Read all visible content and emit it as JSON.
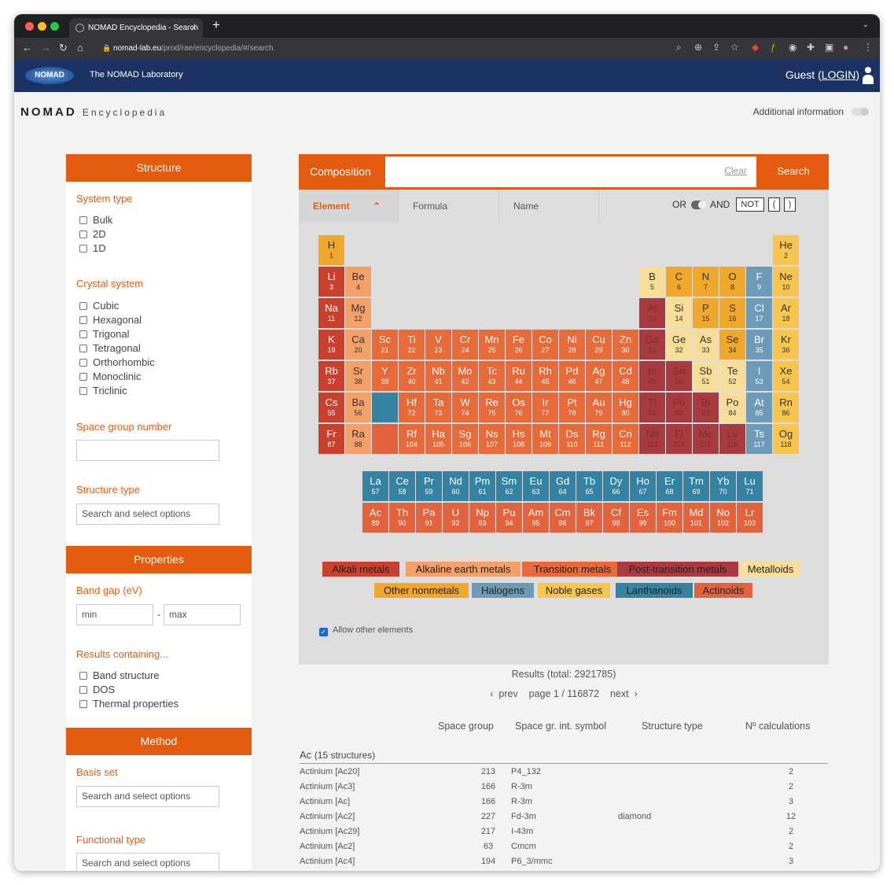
{
  "browser": {
    "tab_title": "NOMAD Encyclopedia - Search",
    "tab_close": "×",
    "new_tab": "+",
    "menu_chevron": "⌄",
    "url_host": "nomad-lab.eu",
    "url_path": "/prod/rae/encyclopedia/#/search"
  },
  "header": {
    "logo": "NOMAD",
    "lab": "The NOMAD Laboratory",
    "guest": "Guest (",
    "login": "LOGIN",
    ")": ")"
  },
  "brand": {
    "name": "NOMAD",
    "sub": "Encyclopedia"
  },
  "additional_info": "Additional information",
  "sidebar": {
    "structure": {
      "title": "Structure",
      "system_type": {
        "label": "System type",
        "options": [
          "Bulk",
          "2D",
          "1D"
        ]
      },
      "crystal_system": {
        "label": "Crystal system",
        "options": [
          "Cubic",
          "Hexagonal",
          "Trigonal",
          "Tetragonal",
          "Orthorhombic",
          "Monoclinic",
          "Triclinic"
        ]
      },
      "space_group": {
        "label": "Space group number",
        "value": ""
      },
      "structure_type": {
        "label": "Structure type",
        "placeholder": "Search and select options"
      }
    },
    "properties": {
      "title": "Properties",
      "band_gap": {
        "label": "Band gap (eV)",
        "min": "min",
        "dash": "-",
        "max": "max"
      },
      "results": {
        "label": "Results containing...",
        "options": [
          "Band structure",
          "DOS",
          "Thermal properties"
        ]
      }
    },
    "method": {
      "title": "Method",
      "basis_set": {
        "label": "Basis set",
        "placeholder": "Search and select options"
      },
      "functional_type": {
        "label": "Functional type",
        "placeholder": "Search and select options"
      }
    }
  },
  "composition": {
    "label": "Composition",
    "value": "",
    "clear": "Clear",
    "search": "Search"
  },
  "tabs": {
    "element": "Element",
    "formula": "Formula",
    "name": "Name",
    "or": "OR",
    "and": "AND",
    "not": "NOT",
    "lparen": "(",
    "rparen": ")"
  },
  "elements": [
    {
      "s": "H",
      "n": "1",
      "c": "on",
      "r": 0,
      "k": 0
    },
    {
      "s": "He",
      "n": "2",
      "c": "ng",
      "r": 0,
      "k": 17
    },
    {
      "s": "Li",
      "n": "3",
      "c": "al",
      "r": 1,
      "k": 0
    },
    {
      "s": "Be",
      "n": "4",
      "c": "ae",
      "r": 1,
      "k": 1
    },
    {
      "s": "B",
      "n": "5",
      "c": "md",
      "r": 1,
      "k": 12
    },
    {
      "s": "C",
      "n": "6",
      "c": "on",
      "r": 1,
      "k": 13
    },
    {
      "s": "N",
      "n": "7",
      "c": "on",
      "r": 1,
      "k": 14
    },
    {
      "s": "O",
      "n": "8",
      "c": "on",
      "r": 1,
      "k": 15
    },
    {
      "s": "F",
      "n": "9",
      "c": "ha",
      "r": 1,
      "k": 16
    },
    {
      "s": "Ne",
      "n": "10",
      "c": "ng",
      "r": 1,
      "k": 17
    },
    {
      "s": "Na",
      "n": "11",
      "c": "al",
      "r": 2,
      "k": 0
    },
    {
      "s": "Mg",
      "n": "12",
      "c": "ae",
      "r": 2,
      "k": 1
    },
    {
      "s": "Al",
      "n": "13",
      "c": "pt",
      "r": 2,
      "k": 12
    },
    {
      "s": "Si",
      "n": "14",
      "c": "md",
      "r": 2,
      "k": 13
    },
    {
      "s": "P",
      "n": "15",
      "c": "on",
      "r": 2,
      "k": 14
    },
    {
      "s": "S",
      "n": "16",
      "c": "on",
      "r": 2,
      "k": 15
    },
    {
      "s": "Cl",
      "n": "17",
      "c": "ha",
      "r": 2,
      "k": 16
    },
    {
      "s": "Ar",
      "n": "18",
      "c": "ng",
      "r": 2,
      "k": 17
    },
    {
      "s": "K",
      "n": "19",
      "c": "al",
      "r": 3,
      "k": 0
    },
    {
      "s": "Ca",
      "n": "20",
      "c": "ae",
      "r": 3,
      "k": 1
    },
    {
      "s": "Sc",
      "n": "21",
      "c": "tm",
      "r": 3,
      "k": 2
    },
    {
      "s": "Ti",
      "n": "22",
      "c": "tm",
      "r": 3,
      "k": 3
    },
    {
      "s": "V",
      "n": "23",
      "c": "tm",
      "r": 3,
      "k": 4
    },
    {
      "s": "Cr",
      "n": "24",
      "c": "tm",
      "r": 3,
      "k": 5
    },
    {
      "s": "Mn",
      "n": "25",
      "c": "tm",
      "r": 3,
      "k": 6
    },
    {
      "s": "Fe",
      "n": "26",
      "c": "tm",
      "r": 3,
      "k": 7
    },
    {
      "s": "Co",
      "n": "27",
      "c": "tm",
      "r": 3,
      "k": 8
    },
    {
      "s": "Ni",
      "n": "28",
      "c": "tm",
      "r": 3,
      "k": 9
    },
    {
      "s": "Cu",
      "n": "29",
      "c": "tm",
      "r": 3,
      "k": 10
    },
    {
      "s": "Zn",
      "n": "30",
      "c": "tm",
      "r": 3,
      "k": 11
    },
    {
      "s": "Ga",
      "n": "31",
      "c": "pt",
      "r": 3,
      "k": 12
    },
    {
      "s": "Ge",
      "n": "32",
      "c": "md",
      "r": 3,
      "k": 13
    },
    {
      "s": "As",
      "n": "33",
      "c": "md",
      "r": 3,
      "k": 14
    },
    {
      "s": "Se",
      "n": "34",
      "c": "on",
      "r": 3,
      "k": 15
    },
    {
      "s": "Br",
      "n": "35",
      "c": "ha",
      "r": 3,
      "k": 16
    },
    {
      "s": "Kr",
      "n": "36",
      "c": "ng",
      "r": 3,
      "k": 17
    },
    {
      "s": "Rb",
      "n": "37",
      "c": "al",
      "r": 4,
      "k": 0
    },
    {
      "s": "Sr",
      "n": "38",
      "c": "ae",
      "r": 4,
      "k": 1
    },
    {
      "s": "Y",
      "n": "39",
      "c": "tm",
      "r": 4,
      "k": 2
    },
    {
      "s": "Zr",
      "n": "40",
      "c": "tm",
      "r": 4,
      "k": 3
    },
    {
      "s": "Nb",
      "n": "41",
      "c": "tm",
      "r": 4,
      "k": 4
    },
    {
      "s": "Mo",
      "n": "42",
      "c": "tm",
      "r": 4,
      "k": 5
    },
    {
      "s": "Tc",
      "n": "43",
      "c": "tm",
      "r": 4,
      "k": 6
    },
    {
      "s": "Ru",
      "n": "44",
      "c": "tm",
      "r": 4,
      "k": 7
    },
    {
      "s": "Rh",
      "n": "45",
      "c": "tm",
      "r": 4,
      "k": 8
    },
    {
      "s": "Pd",
      "n": "46",
      "c": "tm",
      "r": 4,
      "k": 9
    },
    {
      "s": "Ag",
      "n": "47",
      "c": "tm",
      "r": 4,
      "k": 10
    },
    {
      "s": "Cd",
      "n": "48",
      "c": "tm",
      "r": 4,
      "k": 11
    },
    {
      "s": "In",
      "n": "49",
      "c": "pt",
      "r": 4,
      "k": 12
    },
    {
      "s": "Sn",
      "n": "50",
      "c": "pt",
      "r": 4,
      "k": 13
    },
    {
      "s": "Sb",
      "n": "51",
      "c": "md",
      "r": 4,
      "k": 14
    },
    {
      "s": "Te",
      "n": "52",
      "c": "md",
      "r": 4,
      "k": 15
    },
    {
      "s": "I",
      "n": "53",
      "c": "ha",
      "r": 4,
      "k": 16
    },
    {
      "s": "Xe",
      "n": "54",
      "c": "ng",
      "r": 4,
      "k": 17
    },
    {
      "s": "Cs",
      "n": "55",
      "c": "al",
      "r": 5,
      "k": 0
    },
    {
      "s": "Ba",
      "n": "56",
      "c": "ae",
      "r": 5,
      "k": 1
    },
    {
      "s": "",
      "n": "",
      "c": "la",
      "r": 5,
      "k": 2
    },
    {
      "s": "Hf",
      "n": "72",
      "c": "tm",
      "r": 5,
      "k": 3
    },
    {
      "s": "Ta",
      "n": "73",
      "c": "tm",
      "r": 5,
      "k": 4
    },
    {
      "s": "W",
      "n": "74",
      "c": "tm",
      "r": 5,
      "k": 5
    },
    {
      "s": "Re",
      "n": "75",
      "c": "tm",
      "r": 5,
      "k": 6
    },
    {
      "s": "Os",
      "n": "76",
      "c": "tm",
      "r": 5,
      "k": 7
    },
    {
      "s": "Ir",
      "n": "77",
      "c": "tm",
      "r": 5,
      "k": 8
    },
    {
      "s": "Pt",
      "n": "78",
      "c": "tm",
      "r": 5,
      "k": 9
    },
    {
      "s": "Au",
      "n": "79",
      "c": "tm",
      "r": 5,
      "k": 10
    },
    {
      "s": "Hg",
      "n": "80",
      "c": "tm",
      "r": 5,
      "k": 11
    },
    {
      "s": "Tl",
      "n": "81",
      "c": "pt",
      "r": 5,
      "k": 12
    },
    {
      "s": "Pb",
      "n": "82",
      "c": "pt",
      "r": 5,
      "k": 13
    },
    {
      "s": "Bi",
      "n": "83",
      "c": "pt",
      "r": 5,
      "k": 14
    },
    {
      "s": "Po",
      "n": "84",
      "c": "md",
      "r": 5,
      "k": 15
    },
    {
      "s": "At",
      "n": "85",
      "c": "ha",
      "r": 5,
      "k": 16
    },
    {
      "s": "Rn",
      "n": "86",
      "c": "ng",
      "r": 5,
      "k": 17
    },
    {
      "s": "Fr",
      "n": "87",
      "c": "al",
      "r": 6,
      "k": 0
    },
    {
      "s": "Ra",
      "n": "88",
      "c": "ae",
      "r": 6,
      "k": 1
    },
    {
      "s": "",
      "n": "",
      "c": "ac",
      "r": 6,
      "k": 2
    },
    {
      "s": "Rf",
      "n": "104",
      "c": "tm",
      "r": 6,
      "k": 3
    },
    {
      "s": "Ha",
      "n": "105",
      "c": "tm",
      "r": 6,
      "k": 4
    },
    {
      "s": "Sg",
      "n": "106",
      "c": "tm",
      "r": 6,
      "k": 5
    },
    {
      "s": "Ns",
      "n": "107",
      "c": "tm",
      "r": 6,
      "k": 6
    },
    {
      "s": "Hs",
      "n": "108",
      "c": "tm",
      "r": 6,
      "k": 7
    },
    {
      "s": "Mt",
      "n": "109",
      "c": "tm",
      "r": 6,
      "k": 8
    },
    {
      "s": "Ds",
      "n": "110",
      "c": "tm",
      "r": 6,
      "k": 9
    },
    {
      "s": "Rg",
      "n": "111",
      "c": "tm",
      "r": 6,
      "k": 10
    },
    {
      "s": "Cn",
      "n": "112",
      "c": "tm",
      "r": 6,
      "k": 11
    },
    {
      "s": "Nh",
      "n": "113",
      "c": "pt",
      "r": 6,
      "k": 12
    },
    {
      "s": "Fl",
      "n": "114",
      "c": "pt",
      "r": 6,
      "k": 13
    },
    {
      "s": "Mc",
      "n": "115",
      "c": "pt",
      "r": 6,
      "k": 14
    },
    {
      "s": "Lv",
      "n": "116",
      "c": "pt",
      "r": 6,
      "k": 15
    },
    {
      "s": "Ts",
      "n": "117",
      "c": "ha",
      "r": 6,
      "k": 16
    },
    {
      "s": "Og",
      "n": "118",
      "c": "ng",
      "r": 6,
      "k": 17
    },
    {
      "s": "La",
      "n": "57",
      "c": "la",
      "r": 7,
      "k": 0
    },
    {
      "s": "Ce",
      "n": "58",
      "c": "la",
      "r": 7,
      "k": 1
    },
    {
      "s": "Pr",
      "n": "59",
      "c": "la",
      "r": 7,
      "k": 2
    },
    {
      "s": "Nd",
      "n": "60",
      "c": "la",
      "r": 7,
      "k": 3
    },
    {
      "s": "Pm",
      "n": "61",
      "c": "la",
      "r": 7,
      "k": 4
    },
    {
      "s": "Sm",
      "n": "62",
      "c": "la",
      "r": 7,
      "k": 5
    },
    {
      "s": "Eu",
      "n": "63",
      "c": "la",
      "r": 7,
      "k": 6
    },
    {
      "s": "Gd",
      "n": "64",
      "c": "la",
      "r": 7,
      "k": 7
    },
    {
      "s": "Tb",
      "n": "65",
      "c": "la",
      "r": 7,
      "k": 8
    },
    {
      "s": "Dy",
      "n": "66",
      "c": "la",
      "r": 7,
      "k": 9
    },
    {
      "s": "Ho",
      "n": "67",
      "c": "la",
      "r": 7,
      "k": 10
    },
    {
      "s": "Er",
      "n": "68",
      "c": "la",
      "r": 7,
      "k": 11
    },
    {
      "s": "Tm",
      "n": "69",
      "c": "la",
      "r": 7,
      "k": 12
    },
    {
      "s": "Yb",
      "n": "70",
      "c": "la",
      "r": 7,
      "k": 13
    },
    {
      "s": "Lu",
      "n": "71",
      "c": "la",
      "r": 7,
      "k": 14
    },
    {
      "s": "Ac",
      "n": "89",
      "c": "ac",
      "r": 8,
      "k": 0
    },
    {
      "s": "Th",
      "n": "90",
      "c": "ac",
      "r": 8,
      "k": 1
    },
    {
      "s": "Pa",
      "n": "91",
      "c": "ac",
      "r": 8,
      "k": 2
    },
    {
      "s": "U",
      "n": "92",
      "c": "ac",
      "r": 8,
      "k": 3
    },
    {
      "s": "Np",
      "n": "93",
      "c": "ac",
      "r": 8,
      "k": 4
    },
    {
      "s": "Pu",
      "n": "94",
      "c": "ac",
      "r": 8,
      "k": 5
    },
    {
      "s": "Am",
      "n": "95",
      "c": "ac",
      "r": 8,
      "k": 6
    },
    {
      "s": "Cm",
      "n": "96",
      "c": "ac",
      "r": 8,
      "k": 7
    },
    {
      "s": "Bk",
      "n": "97",
      "c": "ac",
      "r": 8,
      "k": 8
    },
    {
      "s": "Cf",
      "n": "98",
      "c": "ac",
      "r": 8,
      "k": 9
    },
    {
      "s": "Es",
      "n": "99",
      "c": "ac",
      "r": 8,
      "k": 10
    },
    {
      "s": "Fm",
      "n": "100",
      "c": "ac",
      "r": 8,
      "k": 11
    },
    {
      "s": "Md",
      "n": "101",
      "c": "ac",
      "r": 8,
      "k": 12
    },
    {
      "s": "No",
      "n": "102",
      "c": "ac",
      "r": 8,
      "k": 13
    },
    {
      "s": "Lr",
      "n": "103",
      "c": "ac",
      "r": 8,
      "k": 14
    }
  ],
  "colors": {
    "al": "#c9412e",
    "ae": "#f2a068",
    "tm": "#e66a3a",
    "pt": "#a83a42",
    "md": "#f8dd99",
    "on": "#f0a82c",
    "ha": "#6d9bb7",
    "ng": "#f6c64e",
    "la": "#3583a2",
    "ac": "#e4633f"
  },
  "legend": [
    {
      "label": "Alkali metals",
      "c": "al"
    },
    {
      "label": "Alkaline earth metals",
      "c": "ae"
    },
    {
      "label": "Transition metals",
      "c": "tm"
    },
    {
      "label": "Post-transition metals",
      "c": "pt"
    },
    {
      "label": "Metalloids",
      "c": "md"
    },
    {
      "label": "Other nonmetals",
      "c": "on"
    },
    {
      "label": "Halogens",
      "c": "ha"
    },
    {
      "label": "Noble gases",
      "c": "ng"
    },
    {
      "label": "Lanthanoids",
      "c": "la"
    },
    {
      "label": "Actinoids",
      "c": "ac"
    }
  ],
  "allow_other": "Allow other elements",
  "results": {
    "total": "Results (total: 2921785)",
    "prev": "prev",
    "page": "page 1 / 116872",
    "next": "next",
    "columns": [
      "Space group",
      "Space gr. int. symbol",
      "Structure type",
      "Nº calculations"
    ],
    "group": "Ac",
    "group_count": "(15 structures)",
    "rows": [
      [
        "Actinium [Ac20]",
        "213",
        "P4_132",
        "",
        "2"
      ],
      [
        "Actinium [Ac3]",
        "166",
        "R-3m",
        "",
        "2"
      ],
      [
        "Actinium [Ac]",
        "166",
        "R-3m",
        "",
        "3"
      ],
      [
        "Actinium [Ac2]",
        "227",
        "Fd-3m",
        "diamond",
        "12"
      ],
      [
        "Actinium [Ac29]",
        "217",
        "I-43m",
        "",
        "2"
      ],
      [
        "Actinium [Ac2]",
        "63",
        "Cmcm",
        "",
        "2"
      ],
      [
        "Actinium [Ac4]",
        "194",
        "P6_3/mmc",
        "",
        "3"
      ]
    ]
  }
}
